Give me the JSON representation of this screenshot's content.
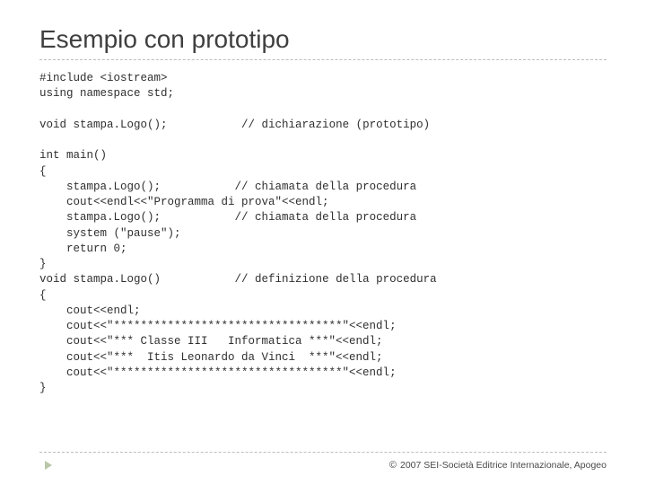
{
  "title": "Esempio con prototipo",
  "code": {
    "l01": "#include <iostream>",
    "l02": "using namespace std;",
    "l03": "",
    "l04a": "void stampa.Logo();",
    "l04b": "// dichiarazione (prototipo)",
    "l05": "",
    "l06": "int main()",
    "l07": "{",
    "l08a": "    stampa.Logo();",
    "l08b": "// chiamata della procedura",
    "l09": "    cout<<endl<<\"Programma di prova\"<<endl;",
    "l10a": "    stampa.Logo();",
    "l10b": "// chiamata della procedura",
    "l11": "    system (\"pause\");",
    "l12": "    return 0;",
    "l13": "}",
    "l14a": "void stampa.Logo()",
    "l14b": "// definizione della procedura",
    "l15": "{",
    "l16": "    cout<<endl;",
    "l17": "    cout<<\"**********************************\"<<endl;",
    "l18": "    cout<<\"*** Classe III   Informatica ***\"<<endl;",
    "l19": "    cout<<\"***  Itis Leonardo da Vinci  ***\"<<endl;",
    "l20": "    cout<<\"**********************************\"<<endl;",
    "l21": "}"
  },
  "footer": {
    "copyright_symbol": "©",
    "text": "2007 SEI-Società Editrice Internazionale, Apogeo"
  }
}
